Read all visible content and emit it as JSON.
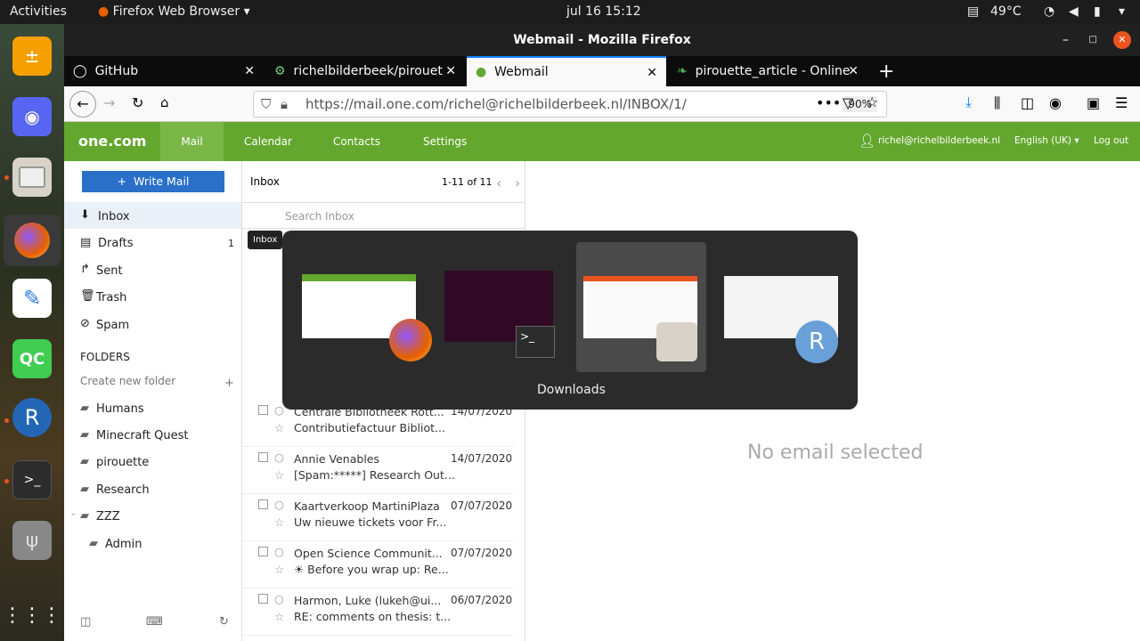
{
  "topbar": {
    "activities": "Activities",
    "app": "Firefox Web Browser",
    "clock": "jul 16  15:12",
    "temp": "49°C"
  },
  "window": {
    "title": "Webmail - Mozilla Firefox"
  },
  "tabs": [
    {
      "label": "GitHub"
    },
    {
      "label": "richelbilderbeek/pirouet"
    },
    {
      "label": "Webmail"
    },
    {
      "label": "pirouette_article - Online"
    }
  ],
  "url": {
    "text": "https://mail.one.com/richel@richelbilderbeek.nl/INBOX/1/",
    "zoom": "90%"
  },
  "onecom": {
    "logo": "one.com",
    "nav": [
      "Mail",
      "Calendar",
      "Contacts",
      "Settings"
    ],
    "user": "richel@richelbilderbeek.nl",
    "lang": "English (UK)",
    "logout": "Log out"
  },
  "sidebar": {
    "write": "Write Mail",
    "inbox": "Inbox",
    "drafts": "Drafts",
    "drafts_count": "1",
    "sent": "Sent",
    "trash": "Trash",
    "spam": "Spam",
    "folders_header": "FOLDERS",
    "create_folder": "Create new folder",
    "folders": [
      "Humans",
      "Minecraft Quest",
      "pirouette",
      "Research",
      "ZZZ",
      "Admin"
    ]
  },
  "list": {
    "title": "Inbox",
    "count": "1-11 of 11",
    "search_placeholder": "Search Inbox",
    "tooltip": "Inbox",
    "rows": [
      {
        "from": "Centrale Bibliotheek Rott...",
        "date": "14/07/2020",
        "subject": "Contributiefactuur Bibliot..."
      },
      {
        "from": "Annie Venables",
        "date": "14/07/2020",
        "subject": "[Spam:*****] Research Out..."
      },
      {
        "from": "Kaartverkoop MartiniPlaza",
        "date": "07/07/2020",
        "subject": "Uw nieuwe tickets voor Fr..."
      },
      {
        "from": "Open Science Communit...",
        "date": "07/07/2020",
        "subject": "☀ Before you wrap up: Re..."
      },
      {
        "from": "Harmon, Luke (lukeh@ui...",
        "date": "06/07/2020",
        "subject": "RE: comments on thesis: t..."
      }
    ]
  },
  "reader": {
    "empty": "No email selected"
  },
  "switcher": {
    "selected_label": "Downloads"
  }
}
